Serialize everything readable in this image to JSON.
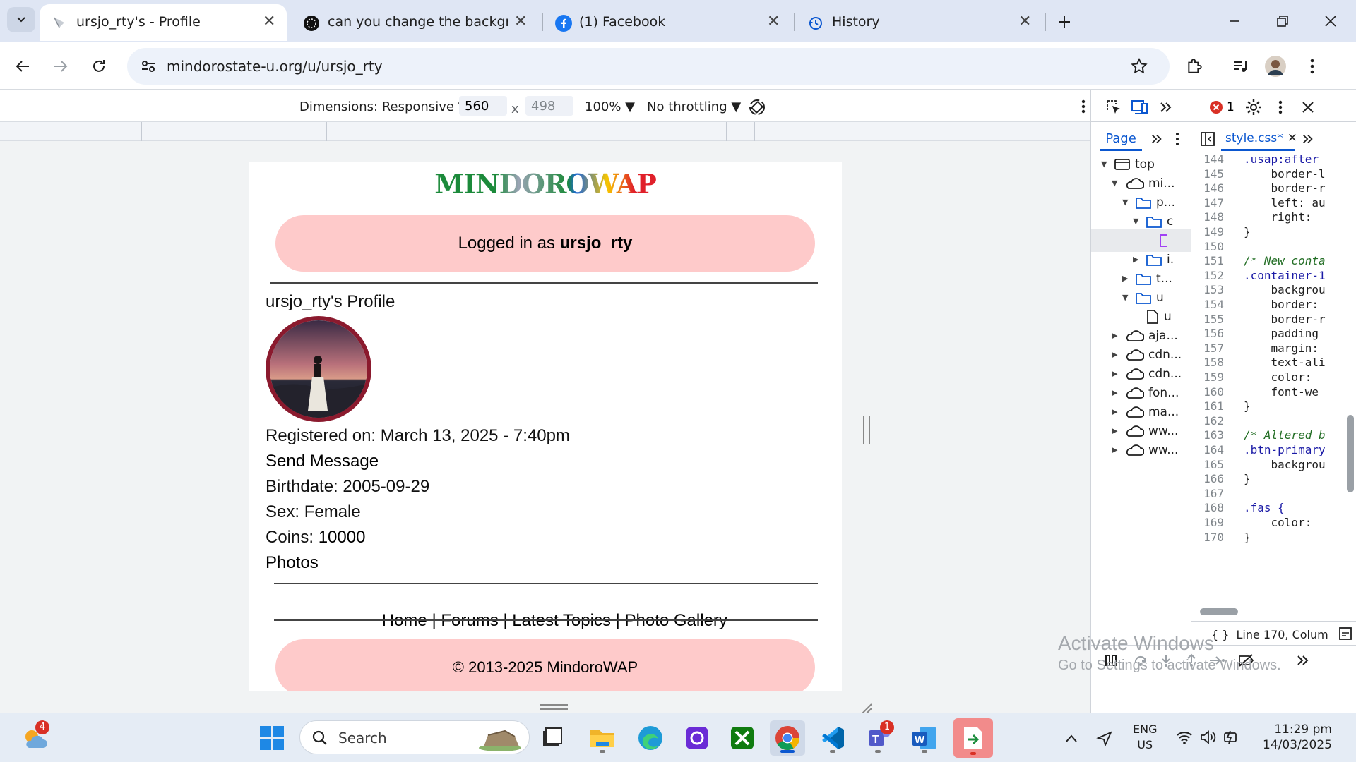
{
  "tabs": [
    {
      "title": "ursjo_rty's - Profile",
      "icon": "generic-site-icon"
    },
    {
      "title": "can you change the backgroun",
      "icon": "chatgpt-icon"
    },
    {
      "title": "(1) Facebook",
      "icon": "facebook-icon"
    },
    {
      "title": "History",
      "icon": "history-icon"
    }
  ],
  "address": {
    "url": "mindorostate-u.org/u/ursjo_rty"
  },
  "device_toolbar": {
    "dimensions_label": "Dimensions: Responsive ▼",
    "width": "560",
    "times": "x",
    "height": "498",
    "zoom": "100% ▼",
    "throttling": "No throttling ▼"
  },
  "page": {
    "logo_text": "MINDOROWAP",
    "logged_prefix": "Logged in as ",
    "logged_user": "ursjo_rty",
    "profile_heading": "ursjo_rty's Profile",
    "registered": "Registered on: March 13, 2025 - 7:40pm",
    "send_message": "Send Message",
    "birthdate": "Birthdate: 2005-09-29",
    "sex": "Sex: Female",
    "coins_label": "Coins: ",
    "coins_value": "10000",
    "photos": "Photos",
    "footer_nav": {
      "home": "Home",
      "forums": "Forums",
      "latest": "Latest Topics",
      "gallery": "Photo Gallery",
      "sep": " | "
    },
    "copyright": "© 2013-2025 MindoroWAP"
  },
  "devtools": {
    "error_count": "1",
    "sources_tab": "Page",
    "file_tab": "style.css*",
    "tree": [
      {
        "label": "top",
        "indent": 0,
        "arrow": "down",
        "icon": "frame"
      },
      {
        "label": "mi...",
        "indent": 1,
        "arrow": "down",
        "icon": "cloud"
      },
      {
        "label": "p...",
        "indent": 2,
        "arrow": "down",
        "icon": "folder"
      },
      {
        "label": "c",
        "indent": 3,
        "arrow": "down",
        "icon": "folder"
      },
      {
        "label": "",
        "indent": 4,
        "arrow": "",
        "icon": "file-purple"
      },
      {
        "label": "i.",
        "indent": 3,
        "arrow": "right",
        "icon": "folder"
      },
      {
        "label": "t...",
        "indent": 2,
        "arrow": "right",
        "icon": "folder"
      },
      {
        "label": "u",
        "indent": 2,
        "arrow": "down",
        "icon": "folder"
      },
      {
        "label": "u",
        "indent": 3,
        "arrow": "",
        "icon": "file"
      },
      {
        "label": "aja...",
        "indent": 1,
        "arrow": "right",
        "icon": "cloud"
      },
      {
        "label": "cdn...",
        "indent": 1,
        "arrow": "right",
        "icon": "cloud"
      },
      {
        "label": "cdn...",
        "indent": 1,
        "arrow": "right",
        "icon": "cloud"
      },
      {
        "label": "fon...",
        "indent": 1,
        "arrow": "right",
        "icon": "cloud"
      },
      {
        "label": "ma...",
        "indent": 1,
        "arrow": "right",
        "icon": "cloud"
      },
      {
        "label": "ww...",
        "indent": 1,
        "arrow": "right",
        "icon": "cloud"
      },
      {
        "label": "ww...",
        "indent": 1,
        "arrow": "right",
        "icon": "cloud"
      }
    ],
    "code": [
      {
        "n": "144",
        "t": ".usap:after",
        "c": "sel"
      },
      {
        "n": "145",
        "t": "    border-l",
        "c": "prop"
      },
      {
        "n": "146",
        "t": "    border-r",
        "c": "prop"
      },
      {
        "n": "147",
        "t": "    left: au",
        "c": "prop"
      },
      {
        "n": "148",
        "t": "    right:",
        "c": "prop"
      },
      {
        "n": "149",
        "t": "}",
        "c": "plain"
      },
      {
        "n": "150",
        "t": "",
        "c": "plain"
      },
      {
        "n": "151",
        "t": "/* New conta",
        "c": "comment"
      },
      {
        "n": "152",
        "t": ".container-1",
        "c": "sel"
      },
      {
        "n": "153",
        "t": "    backgrou",
        "c": "prop"
      },
      {
        "n": "154",
        "t": "    border:",
        "c": "prop"
      },
      {
        "n": "155",
        "t": "    border-r",
        "c": "prop"
      },
      {
        "n": "156",
        "t": "    padding",
        "c": "prop"
      },
      {
        "n": "157",
        "t": "    margin:",
        "c": "prop"
      },
      {
        "n": "158",
        "t": "    text-ali",
        "c": "prop"
      },
      {
        "n": "159",
        "t": "    color:",
        "c": "prop"
      },
      {
        "n": "160",
        "t": "    font-we",
        "c": "prop"
      },
      {
        "n": "161",
        "t": "}",
        "c": "plain"
      },
      {
        "n": "162",
        "t": "",
        "c": "plain"
      },
      {
        "n": "163",
        "t": "/* Altered b",
        "c": "comment"
      },
      {
        "n": "164",
        "t": ".btn-primary",
        "c": "sel"
      },
      {
        "n": "165",
        "t": "    backgrou",
        "c": "prop"
      },
      {
        "n": "166",
        "t": "}",
        "c": "plain"
      },
      {
        "n": "167",
        "t": "",
        "c": "plain"
      },
      {
        "n": "168",
        "t": ".fas {",
        "c": "sel"
      },
      {
        "n": "169",
        "t": "    color:",
        "c": "prop"
      },
      {
        "n": "170",
        "t": "}",
        "c": "plain"
      }
    ],
    "status": "Line 170, Colum"
  },
  "watermark": {
    "line1": "Activate Windows",
    "line2": "Go to Settings to activate Windows."
  },
  "taskbar": {
    "weather_badge": "4",
    "search_placeholder": "Search",
    "teams_badge": "1",
    "lang1": "ENG",
    "lang2": "US",
    "time": "11:29 pm",
    "date": "14/03/2025"
  },
  "colors": {
    "accent": "#0b57d0",
    "pill": "#fecaca",
    "tabbar": "#dfe6f4",
    "taskbar": "#e5ecf5",
    "error": "#d93025"
  }
}
